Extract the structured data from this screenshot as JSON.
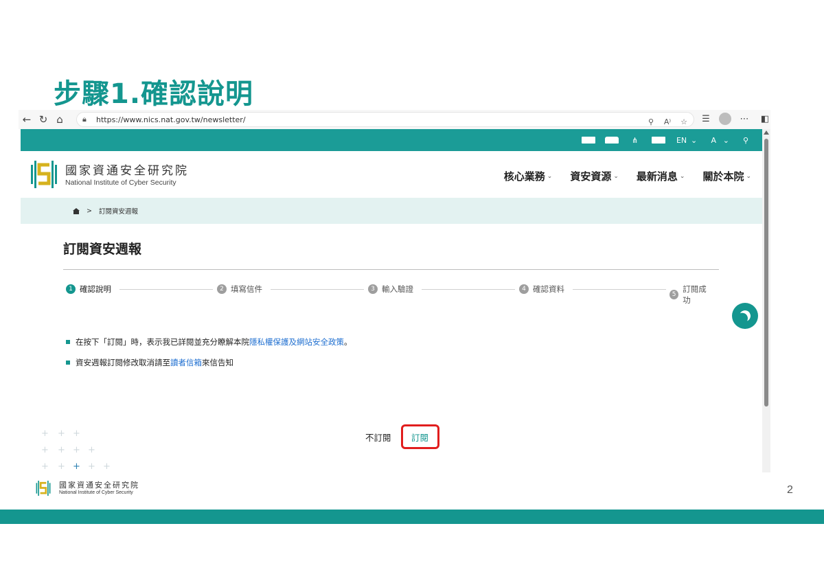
{
  "slide": {
    "title": "步驟1.確認說明",
    "page_number": "2",
    "footer_org_zh": "國家資通安全研究院",
    "footer_org_en": "National Institute of Cyber Security",
    "accent_color": "#14968f"
  },
  "browser": {
    "url": "https://www.nics.nat.gov.tw/newsletter/"
  },
  "site": {
    "topbar": {
      "lang_label": "EN",
      "font_label": "A"
    },
    "org_zh": "國家資通安全研究院",
    "org_en": "National Institute of Cyber Security",
    "nav": [
      "核心業務",
      "資安資源",
      "最新消息",
      "關於本院"
    ],
    "breadcrumb": {
      "current": "訂閱資安週報"
    },
    "page_title": "訂閱資安週報",
    "steps": [
      {
        "num": "1",
        "label": "確認說明",
        "active": true
      },
      {
        "num": "2",
        "label": "填寫信件",
        "active": false
      },
      {
        "num": "3",
        "label": "輸入驗證",
        "active": false
      },
      {
        "num": "4",
        "label": "確認資料",
        "active": false
      },
      {
        "num": "5",
        "label": "訂閱成功",
        "active": false
      }
    ],
    "notes": {
      "first_prefix": "在按下「訂閱」時，表示我已詳閱並充分瞭解本院",
      "first_link": "隱私權保護及網站安全政策",
      "first_suffix": "。",
      "second_prefix": "資安週報訂閱修改取消請至",
      "second_link": "讀者信箱",
      "second_suffix": "來信告知"
    },
    "buttons": {
      "cancel": "不訂閱",
      "subscribe": "訂閱"
    }
  }
}
